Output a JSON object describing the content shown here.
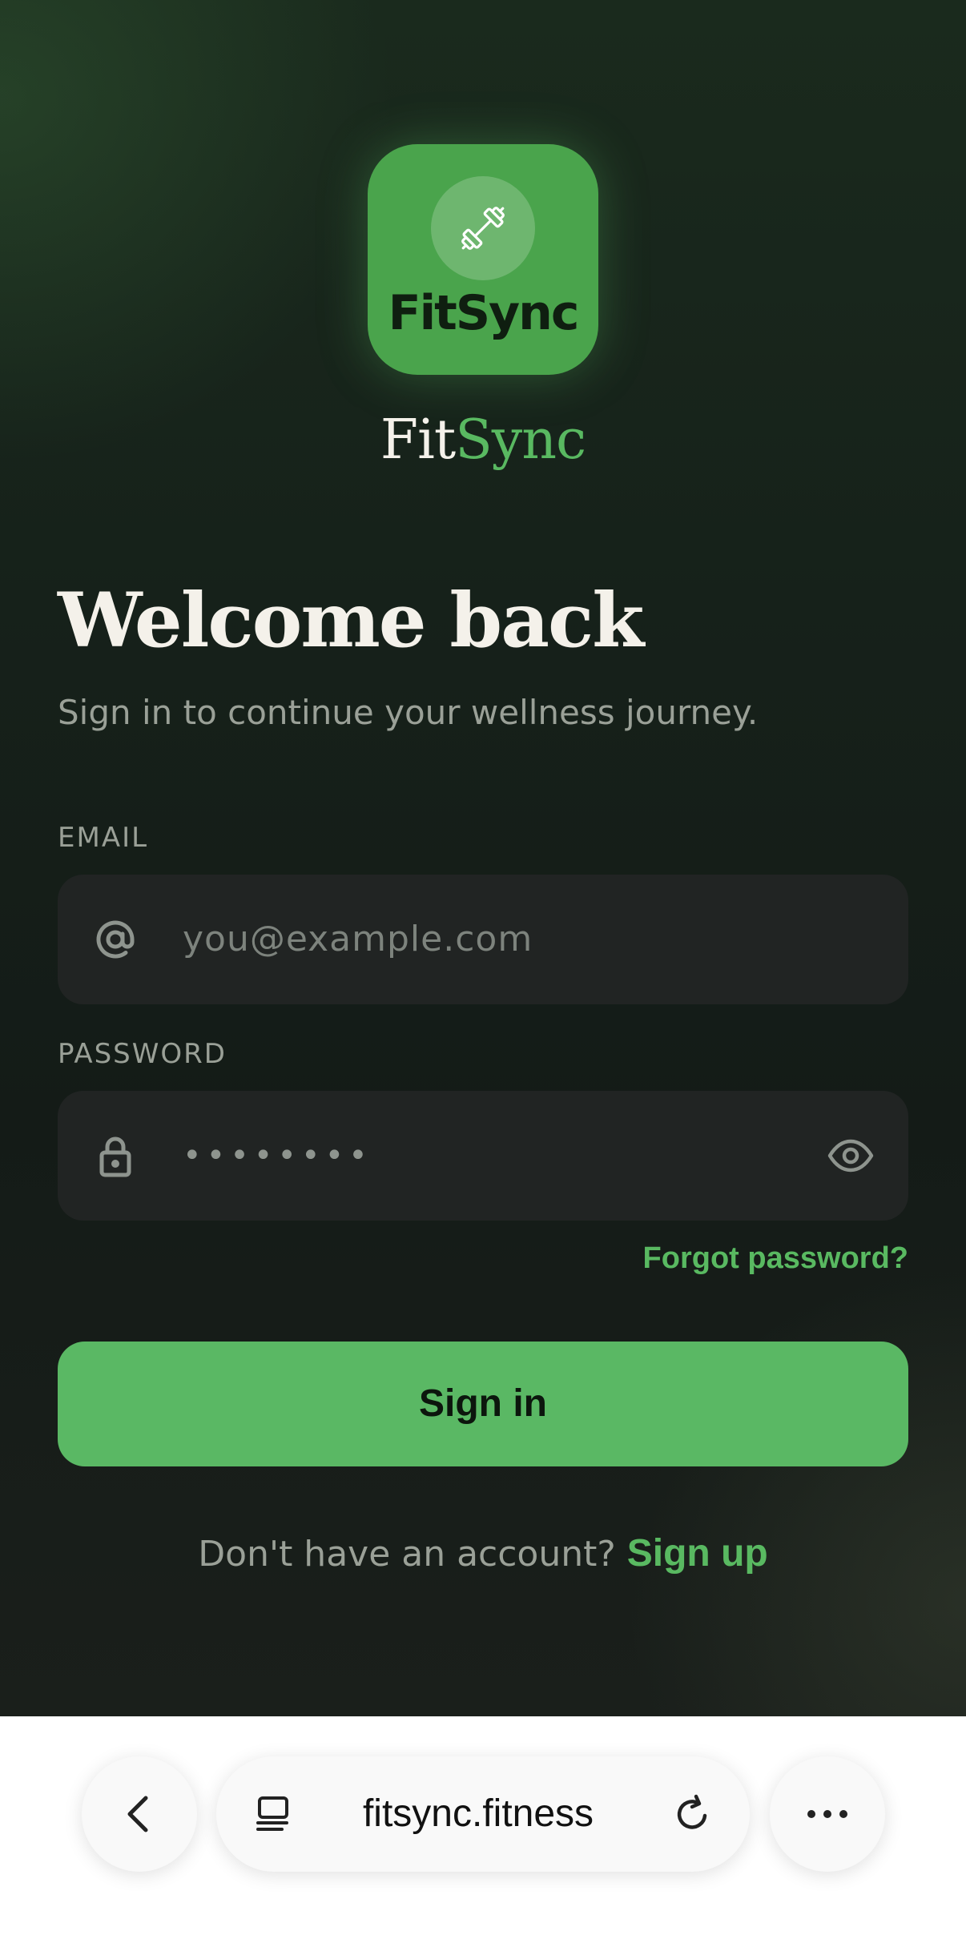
{
  "app": {
    "logo_text": "FitSync",
    "brand": {
      "part1": "Fit",
      "part2": "Sync"
    },
    "colors": {
      "accent": "#59b961",
      "background": "#16211a",
      "field": "#212423"
    }
  },
  "login": {
    "heading": "Welcome back",
    "subtitle": "Sign in to continue your wellness journey.",
    "email_label": "EMAIL",
    "email_placeholder": "you@example.com",
    "password_label": "PASSWORD",
    "password_value": "••••••••",
    "forgot_password": "Forgot password?",
    "signin_button": "Sign in",
    "signup_prompt": "Don't have an account?",
    "signup_link": "Sign up"
  },
  "browser": {
    "url": "fitsync.fitness",
    "icons": [
      "back-icon",
      "tab-icon",
      "reload-icon",
      "more-icon"
    ]
  }
}
